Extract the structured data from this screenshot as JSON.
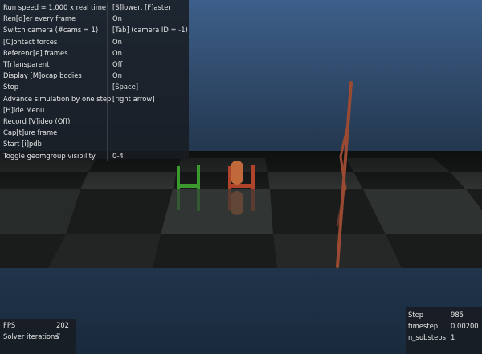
{
  "help_menu": [
    {
      "label": "Run speed = 1.000 x real time",
      "value": "[S]lower, [F]aster"
    },
    {
      "label": "Ren[d]er every frame",
      "value": "On"
    },
    {
      "label": "Switch camera (#cams = 1)",
      "value": "[Tab] (camera ID = -1)"
    },
    {
      "label": "[C]ontact forces",
      "value": "On"
    },
    {
      "label": "Referenc[e] frames",
      "value": "On"
    },
    {
      "label": "T[r]ansparent",
      "value": "Off"
    },
    {
      "label": "Display [M]ocap bodies",
      "value": "On"
    },
    {
      "label": "Stop",
      "value": "[Space]"
    },
    {
      "label": "Advance simulation by one step",
      "value": "[right arrow]"
    },
    {
      "label": "[H]ide Menu",
      "value": ""
    },
    {
      "label": "Record [V]ideo (Off)",
      "value": ""
    },
    {
      "label": "Cap[t]ure frame",
      "value": ""
    },
    {
      "label": "Start [i]pdb",
      "value": ""
    },
    {
      "label": "Toggle geomgroup visibility",
      "value": "0-4"
    }
  ],
  "fps_panel": [
    {
      "label": "FPS",
      "value": "202"
    },
    {
      "label": "Solver iterations",
      "value": "7"
    }
  ],
  "stats_panel": [
    {
      "label": "Step",
      "value": "985"
    },
    {
      "label": "timestep",
      "value": "0.00200"
    },
    {
      "label": "n_substeps",
      "value": "1"
    }
  ],
  "colors": {
    "sky_top": "#3d5f8a",
    "sky_horizon": "#1d2e43",
    "floor_dark": "#151616",
    "floor_light": "#2a2e2c",
    "green_body": "#3b9a2e",
    "red_body": "#b0442b",
    "pole": "#9a4a32"
  }
}
